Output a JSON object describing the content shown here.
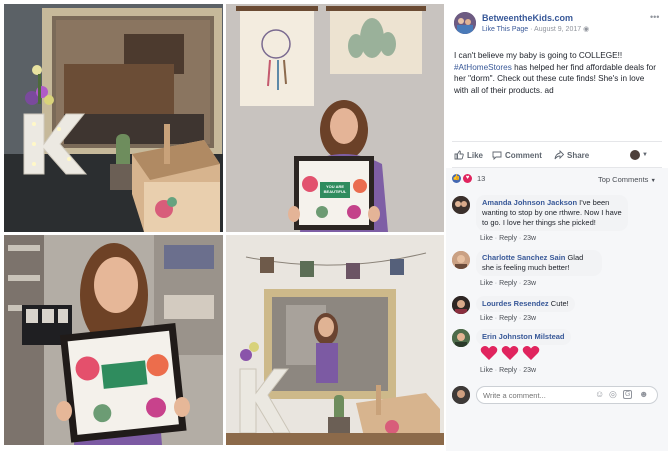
{
  "post": {
    "page_name": "BetweentheKids.com",
    "like_page": "Like This Page",
    "date": "August 9, 2017",
    "text_line1": "I can't believe my baby is going to COLLEGE!!",
    "hashtag": "#AtHomeStores",
    "text_rest": "has helped her find affordable deals for her \"dorm\". Check out these cute finds! She's in love with all of their products. ad",
    "photo_sign_text": "YOU ARE BEAUTIFUL"
  },
  "actions": {
    "like": "Like",
    "comment": "Comment",
    "share": "Share"
  },
  "reactions": {
    "count": "13",
    "sort": "Top Comments"
  },
  "comments": [
    {
      "author": "Amanda Johnson Jackson",
      "text": "I've been wanting to stop by one rthwre. Now I have to go. I love her things she picked!",
      "like": "Like",
      "reply": "Reply",
      "time": "23w"
    },
    {
      "author": "Charlotte Sanchez Sain",
      "text": "Glad she is feeling much better!",
      "like": "Like",
      "reply": "Reply",
      "time": "23w"
    },
    {
      "author": "Lourdes Resendez",
      "text": "Cute!",
      "like": "Like",
      "reply": "Reply",
      "time": "23w"
    },
    {
      "author": "Erin Johnston Milstead",
      "text": "",
      "like": "Like",
      "reply": "Reply",
      "time": "23w"
    }
  ],
  "composer": {
    "placeholder": "Write a comment..."
  },
  "colors": {
    "link": "#385898",
    "like_blue": "#4267b2",
    "heart_red": "#e0245e",
    "muted": "#90949c"
  }
}
